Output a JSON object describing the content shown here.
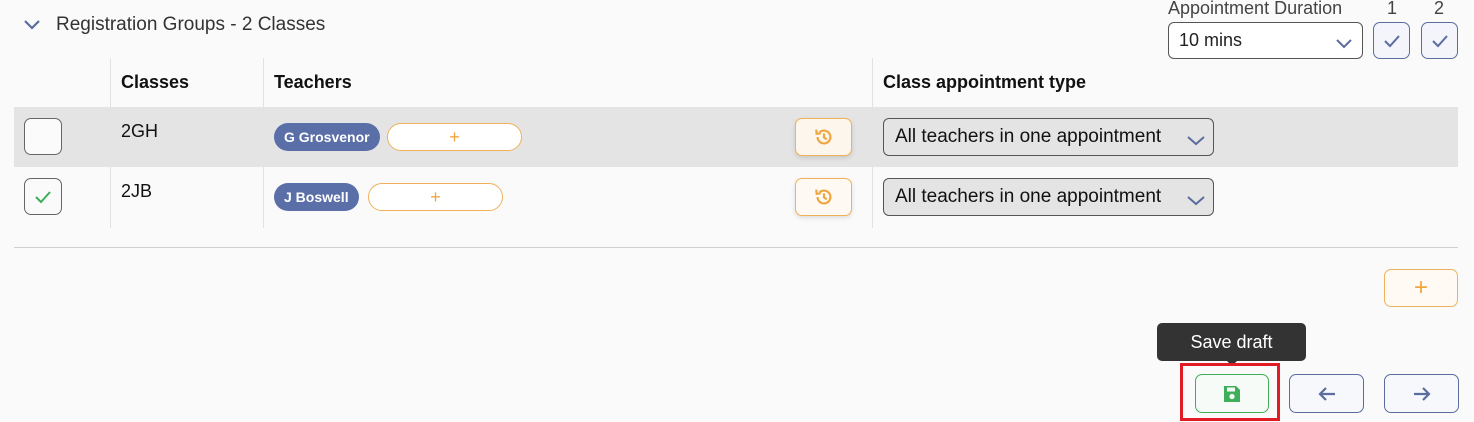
{
  "section": {
    "title": "Registration Groups - 2 Classes",
    "collapse_icon": "chevron-down-icon"
  },
  "duration": {
    "label": "Appointment Duration",
    "value": "10 mins",
    "columns": [
      "1",
      "2"
    ]
  },
  "table": {
    "headers": {
      "select": "",
      "classes": "Classes",
      "teachers": "Teachers",
      "history": "",
      "type": "Class appointment type"
    },
    "rows": [
      {
        "checked": false,
        "class": "2GH",
        "teacher": "G Grosvenor",
        "add_label": "+",
        "appointment_type": "All teachers in one appointment"
      },
      {
        "checked": true,
        "class": "2JB",
        "teacher": "J Boswell",
        "add_label": "+",
        "appointment_type": "All teachers in one appointment"
      }
    ]
  },
  "actions": {
    "add_row_label": "+",
    "tooltip": "Save draft"
  },
  "colors": {
    "accent_blue": "#5a6d9e",
    "teacher_pill": "#5a6ea8",
    "accent_orange": "#f0b15a",
    "save_green": "#3fae5a",
    "highlight_red": "#e01b24"
  }
}
